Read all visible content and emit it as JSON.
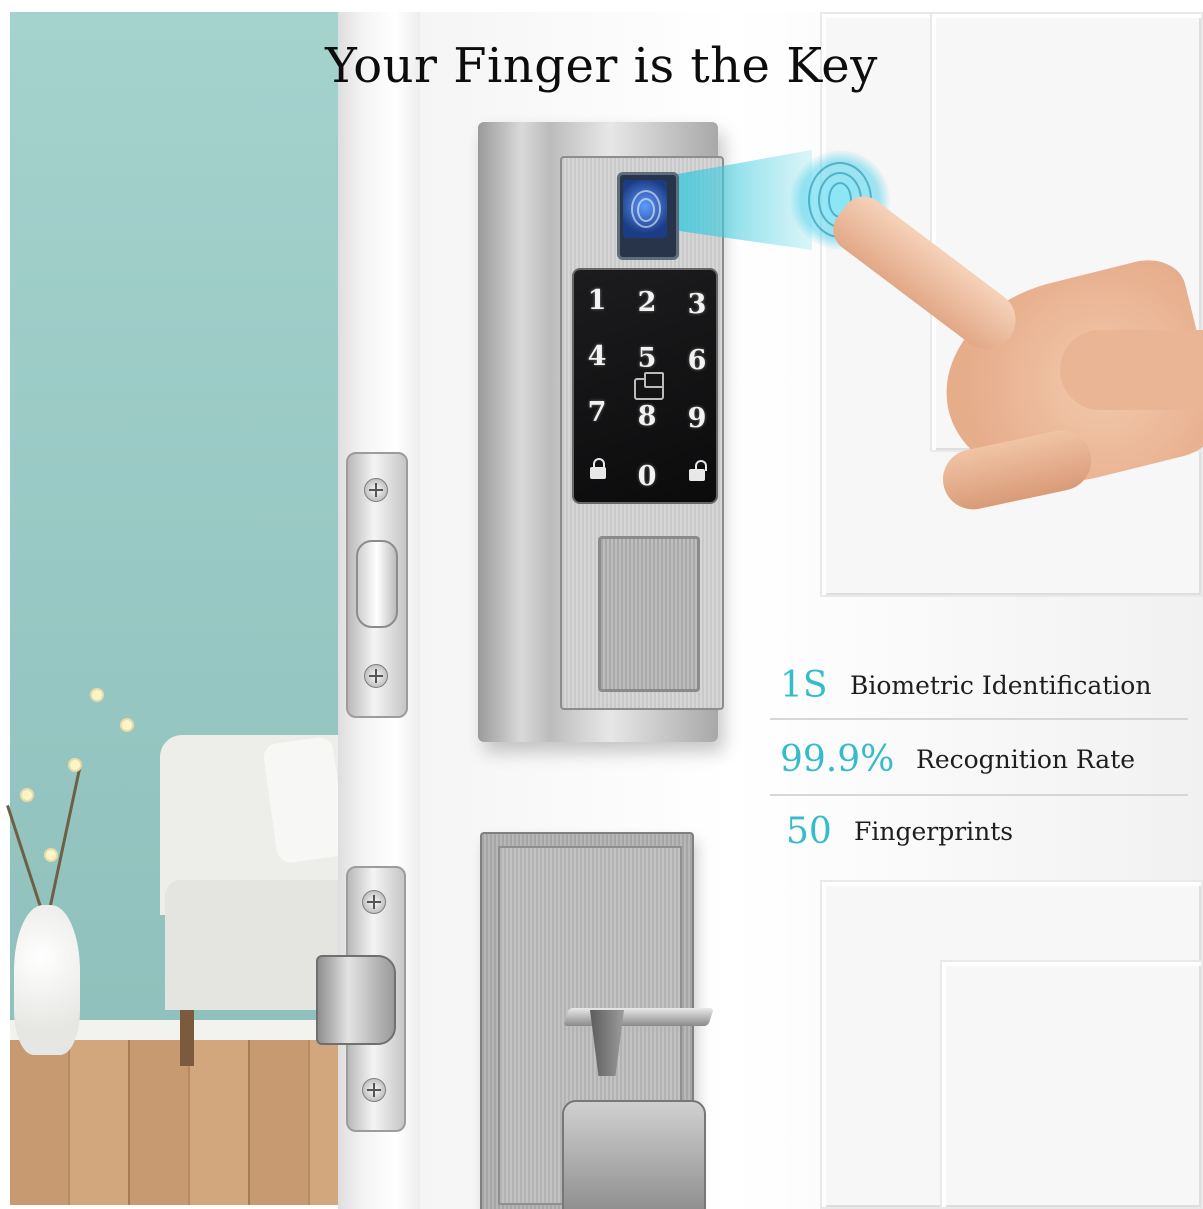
{
  "title": "Your Finger is the Key",
  "keypad": {
    "keys": [
      "1",
      "2",
      "3",
      "4",
      "5",
      "6",
      "7",
      "8",
      "9",
      "0"
    ]
  },
  "features": [
    {
      "value": "1S",
      "label": "Biometric Identification"
    },
    {
      "value": "99.9%",
      "label": "Recognition Rate"
    },
    {
      "value": "50",
      "label": "Fingerprints"
    }
  ],
  "colors": {
    "accent": "#34bccd",
    "title": "#0d0d0d",
    "wall": "#9ccbc6",
    "keypad": "#121213"
  },
  "icons": [
    "fingerprint-icon",
    "padlock-icon",
    "card-icon",
    "screw-icon"
  ]
}
